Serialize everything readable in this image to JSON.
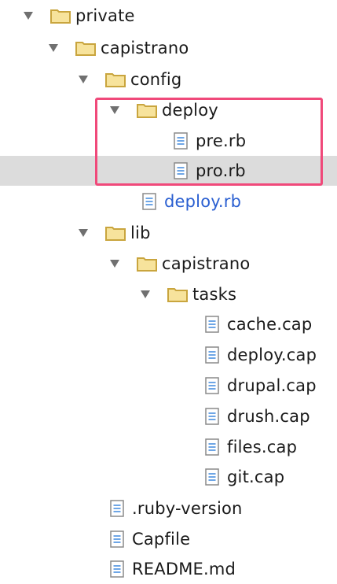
{
  "tree": {
    "items": [
      {
        "label": "private",
        "type": "folder",
        "expanded": true
      },
      {
        "label": "capistrano",
        "type": "folder",
        "expanded": true
      },
      {
        "label": "config",
        "type": "folder",
        "expanded": true
      },
      {
        "label": "deploy",
        "type": "folder",
        "expanded": true
      },
      {
        "label": "pre.rb",
        "type": "file"
      },
      {
        "label": "pro.rb",
        "type": "file",
        "selected": true
      },
      {
        "label": "deploy.rb",
        "type": "file",
        "modified": true
      },
      {
        "label": "lib",
        "type": "folder",
        "expanded": true
      },
      {
        "label": "capistrano",
        "type": "folder",
        "expanded": true
      },
      {
        "label": "tasks",
        "type": "folder",
        "expanded": true
      },
      {
        "label": "cache.cap",
        "type": "file"
      },
      {
        "label": "deploy.cap",
        "type": "file"
      },
      {
        "label": "drupal.cap",
        "type": "file"
      },
      {
        "label": "drush.cap",
        "type": "file"
      },
      {
        "label": "files.cap",
        "type": "file"
      },
      {
        "label": "git.cap",
        "type": "file"
      },
      {
        "label": ".ruby-version",
        "type": "file"
      },
      {
        "label": "Capfile",
        "type": "file"
      },
      {
        "label": "README.md",
        "type": "file"
      }
    ]
  },
  "colors": {
    "folder_fill": "#f7e39c",
    "folder_stroke": "#c9a53e",
    "file_lines": "#4a8fe0",
    "modified_text": "#2a5fd1",
    "selection_bg": "#dcdcdc",
    "highlight_border": "#f0497a"
  },
  "icons": {
    "folder": "folder-icon",
    "file": "file-icon",
    "disclosure": "disclosure-triangle-icon"
  }
}
